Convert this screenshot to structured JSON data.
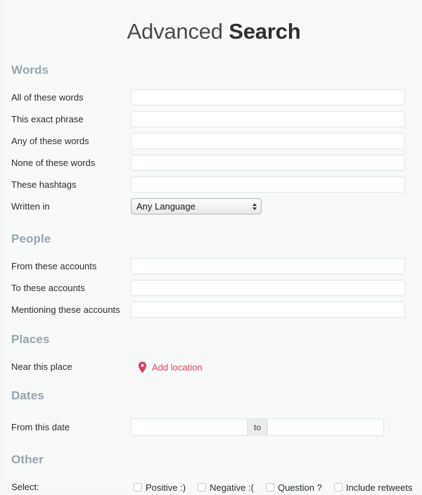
{
  "title": {
    "light": "Advanced ",
    "bold": "Search"
  },
  "sections": {
    "words": {
      "heading": "Words",
      "rows": {
        "all_words": {
          "label": "All of these words",
          "value": "",
          "placeholder": ""
        },
        "exact_phrase": {
          "label": "This exact phrase",
          "value": "",
          "placeholder": ""
        },
        "any_words": {
          "label": "Any of these words",
          "value": "",
          "placeholder": ""
        },
        "none_words": {
          "label": "None of these words",
          "value": "",
          "placeholder": ""
        },
        "hashtags": {
          "label": "These hashtags",
          "value": "",
          "placeholder": ""
        },
        "written_in": {
          "label": "Written in",
          "selected": "Any Language",
          "options": [
            "Any Language"
          ]
        }
      }
    },
    "people": {
      "heading": "People",
      "rows": {
        "from_accounts": {
          "label": "From these accounts",
          "value": "",
          "placeholder": ""
        },
        "to_accounts": {
          "label": "To these accounts",
          "value": "",
          "placeholder": ""
        },
        "mentioning_accounts": {
          "label": "Mentioning these accounts",
          "value": "",
          "placeholder": ""
        }
      }
    },
    "places": {
      "heading": "Places",
      "rows": {
        "near_place": {
          "label": "Near this place",
          "action_label": "Add location",
          "icon": "map-pin-icon"
        }
      }
    },
    "dates": {
      "heading": "Dates",
      "rows": {
        "from_date": {
          "label": "From this date",
          "from_value": "",
          "from_placeholder": "",
          "separator": "to",
          "to_value": "",
          "to_placeholder": ""
        }
      }
    },
    "other": {
      "heading": "Other",
      "rows": {
        "select": {
          "label": "Select:",
          "checkboxes": [
            {
              "label": "Positive :)",
              "checked": false
            },
            {
              "label": "Negative :(",
              "checked": false
            },
            {
              "label": "Question ?",
              "checked": false
            },
            {
              "label": "Include retweets",
              "checked": false
            }
          ]
        }
      }
    }
  },
  "colors": {
    "page_background": "#f8f9f9",
    "heading": "#96a5b0",
    "text": "#292f33",
    "accent_red": "#d9435f",
    "input_border": "#dfe7ea"
  }
}
